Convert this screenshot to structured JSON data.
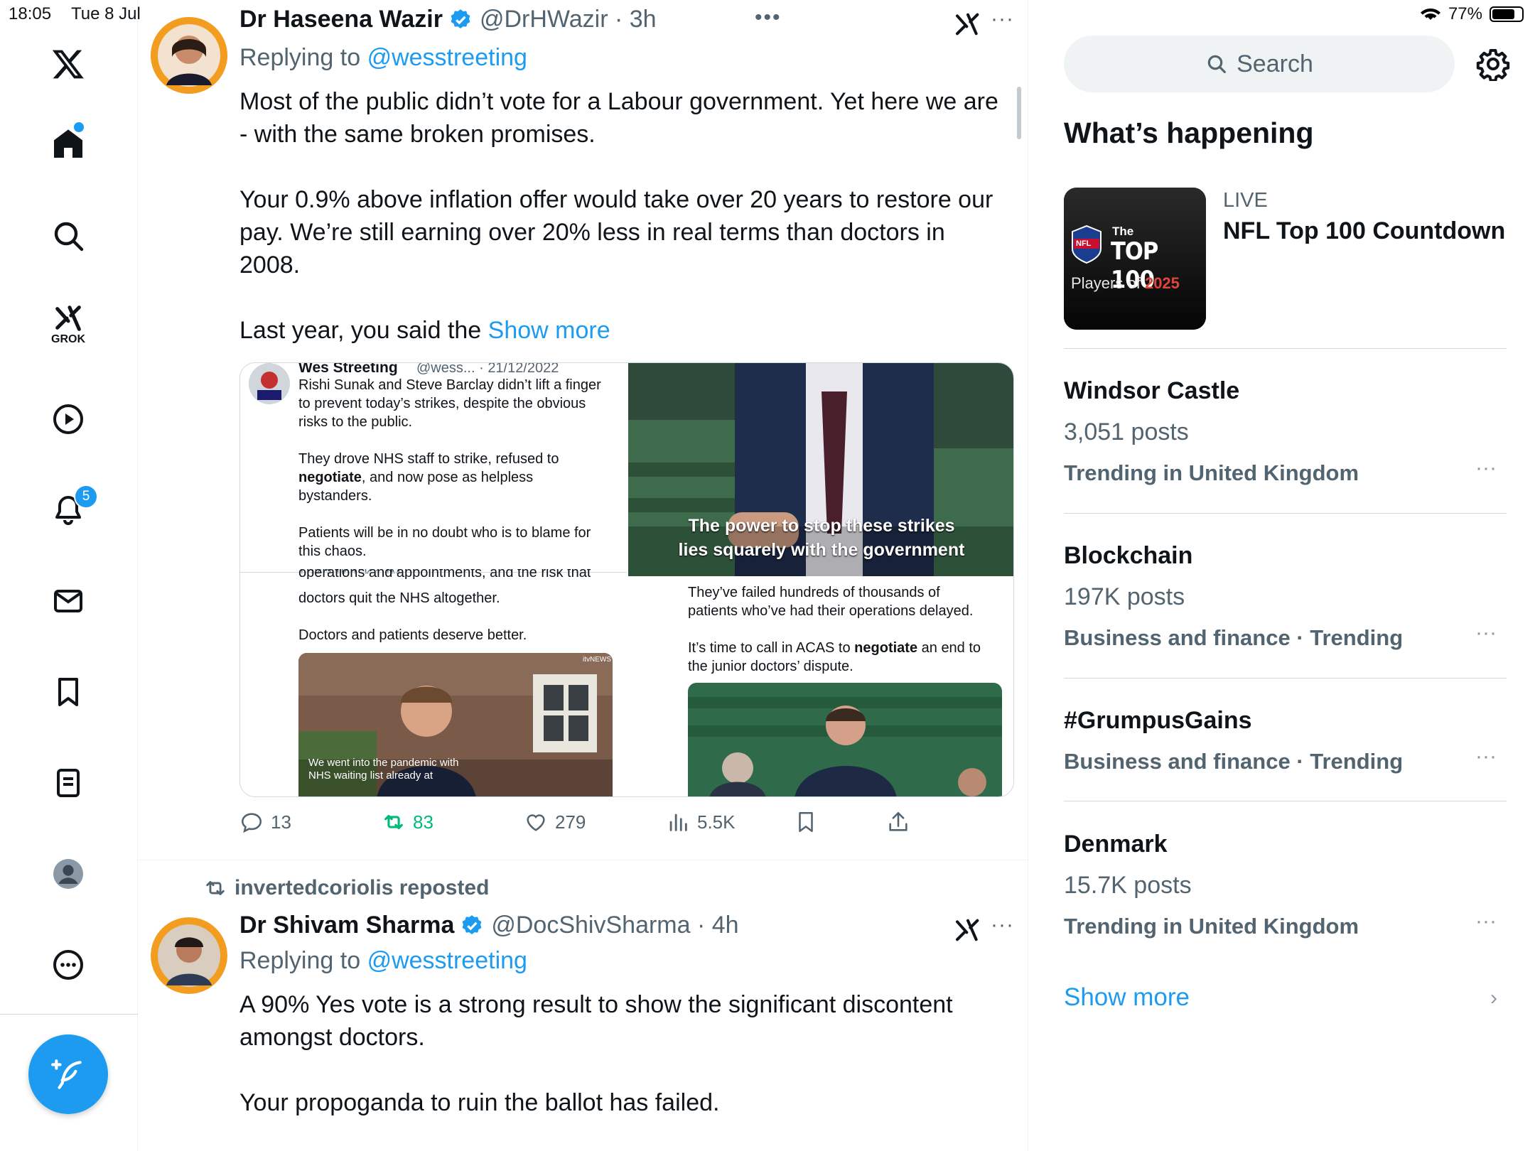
{
  "status_bar": {
    "time": "18:05",
    "date": "Tue 8 Jul",
    "battery": "77%",
    "battery_level": 0.77
  },
  "nav": {
    "notifications_badge": "5",
    "grok_label": "GROK"
  },
  "tweets": [
    {
      "name": "Dr Haseena Wazir",
      "handle": "@DrHWazir · 3h",
      "replying_prefix": "Replying to",
      "replying_to": "@wesstreeting",
      "body_p1": "Most of the public didn’t vote for a Labour government. Yet here we are - with the same broken promises.",
      "body_p2": "Your 0.9% above inflation offer would take over 20 years to restore our pay. We’re still earning over 20% less in real terms than doctors in 2008.",
      "body_p3": "Last year, you said the",
      "show_more": "Show more",
      "media": {
        "quoted_name": "Wes Streeting",
        "quoted_meta": "@wess... · 21/12/2022",
        "q_line1": "Rishi Sunak and Steve Barclay didn’t lift a finger",
        "q_line2": "to prevent today’s strikes, despite the obvious",
        "q_line3": "risks to the public.",
        "q_line4": "They drove NHS staff to strike, refused to",
        "q_line5_bold": "negotiate",
        "q_line5_rest": ", and now pose as helpless",
        "q_line6": "bystanders.",
        "q_line7": "Patients will be in no doubt who is to blame for",
        "q_line8": "this chaos.",
        "q_stats": "1.2K   3.1K   15K   1.1M",
        "q_line9": "operations and appointments, and the risk that",
        "q_line10": "doctors quit the NHS altogether.",
        "q_line11": "Doctors and patients deserve better.",
        "video_caption1": "We went into the pandemic with",
        "video_caption2": "NHS waiting list already at",
        "video_logo": "itvNEWS",
        "right_caption1": "The power to stop these strikes",
        "right_caption2": "lies squarely with the government",
        "r_line1": "They’ve failed hundreds of thousands of",
        "r_line2": "patients who’ve had their operations delayed.",
        "r_line3_pre": "It’s time to call in ACAS to ",
        "r_line3_bold": "negotiate",
        "r_line3_post": " an end to",
        "r_line4": "the junior doctors’ dispute."
      },
      "stats": {
        "replies": "13",
        "reposts": "83",
        "likes": "279",
        "views": "5.5K"
      }
    },
    {
      "repost_by": "invertedcoriolis reposted",
      "name": "Dr Shivam Sharma",
      "handle": "@DocShivSharma · 4h",
      "replying_prefix": "Replying to",
      "replying_to": "@wesstreeting",
      "body_p1": "A 90% Yes vote is a strong result to show the significant discontent amongst doctors.",
      "body_p2": "Your propoganda to ruin the ballot has failed."
    }
  ],
  "right": {
    "search_placeholder": "Search",
    "section_title": "What’s happening",
    "live": {
      "label": "LIVE",
      "title": "NFL Top 100 Countdown",
      "thumb_line1": "The",
      "thumb_line2": "TOP 100",
      "thumb_line3": "Players of",
      "thumb_year": "2025",
      "thumb_nfl": "NFL"
    },
    "trends": [
      {
        "title": "Windsor Castle",
        "posts": "3,051 posts",
        "context": "Trending in United Kingdom"
      },
      {
        "title": "Blockchain",
        "posts": "197K posts",
        "context": "Business and finance · Trending"
      },
      {
        "title": "#GrumpusGains",
        "posts": "",
        "context": "Business and finance · Trending"
      },
      {
        "title": "Denmark",
        "posts": "15.7K posts",
        "context": "Trending in United Kingdom"
      }
    ],
    "show_more": "Show more"
  },
  "colors": {
    "accent": "#1d9bf0",
    "repost_green": "#00ba7c",
    "muted": "#536471"
  }
}
